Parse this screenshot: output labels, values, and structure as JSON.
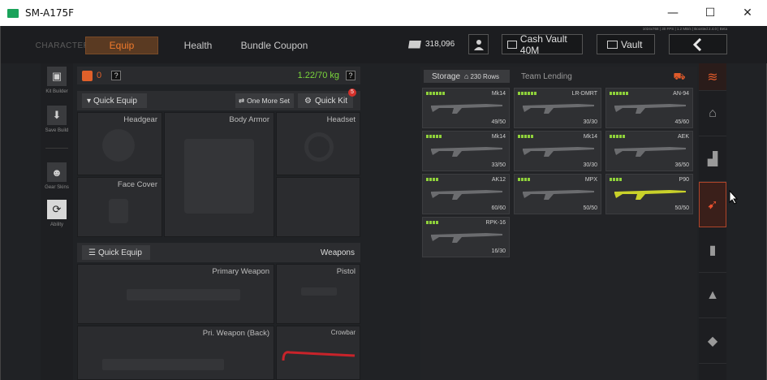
{
  "window": {
    "title": "SM-A175F",
    "minimize_icon": "—",
    "maximize_icon": "☐",
    "close_icon": "✕"
  },
  "tabs": [
    {
      "label": "CHARACTER"
    },
    {
      "label": "Equip"
    },
    {
      "label": "Health"
    },
    {
      "label": "Bundle Coupon"
    }
  ],
  "device_info": "1024x768 | 30 FPS | 1.2 MB/s | Boosted 2.4.0 | Beta",
  "currency": {
    "money": "318,096"
  },
  "cash_vault": "Cash Vault 40M",
  "vault": "Vault",
  "left_menu": {
    "kit_builder": "Kit Builder",
    "save_build": "Save Build",
    "gear_skins": "Gear Skins",
    "ability": "Ability"
  },
  "equip": {
    "level_count": "0",
    "help": "?",
    "weight": "1.22/70 kg",
    "quick_equip": "Quick Equip",
    "one_more_set": "One More Set",
    "quick_kit": "Quick Kit",
    "quick_kit_badge": "5",
    "slots": {
      "headgear": "Headgear",
      "body_armor": "Body Armor",
      "headset": "Headset",
      "face_cover": "Face Cover"
    },
    "weapons_bar": {
      "quick_equip": "Quick Equip",
      "label": "Weapons"
    },
    "weapon_slots": {
      "primary": "Primary Weapon",
      "pistol": "Pistol",
      "pri_back": "Pri. Weapon (Back)",
      "crowbar": "Crowbar"
    }
  },
  "storage": {
    "tab_label": "Storage",
    "rows": "230 Rows",
    "team_lending": "Team Lending",
    "items": [
      {
        "name": "Mk14",
        "count": "49/50",
        "level": 6
      },
      {
        "name": "LR-DMRT",
        "count": "30/30",
        "level": 6
      },
      {
        "name": "AN-94",
        "count": "45/60",
        "level": 6
      },
      {
        "name": "Mk14",
        "count": "33/50",
        "level": 5
      },
      {
        "name": "Mk14",
        "count": "30/30",
        "level": 5
      },
      {
        "name": "AEK",
        "count": "36/50",
        "level": 5
      },
      {
        "name": "AK12",
        "count": "60/60",
        "level": 4
      },
      {
        "name": "MPX",
        "count": "50/50",
        "level": 4
      },
      {
        "name": "P90",
        "count": "50/50",
        "level": 4
      },
      {
        "name": "RPK-16",
        "count": "16/30",
        "level": 4
      }
    ]
  },
  "colors": {
    "accent": "#f07a2c",
    "weight_green": "#7bd63c",
    "level_green": "#8fd13b",
    "active_tab": "#e8502e"
  },
  "right_tabs": [
    "layers-icon",
    "home-icon",
    "armor-icon",
    "gun-icon",
    "magazine-icon",
    "ammo-icon",
    "grenade-icon"
  ]
}
